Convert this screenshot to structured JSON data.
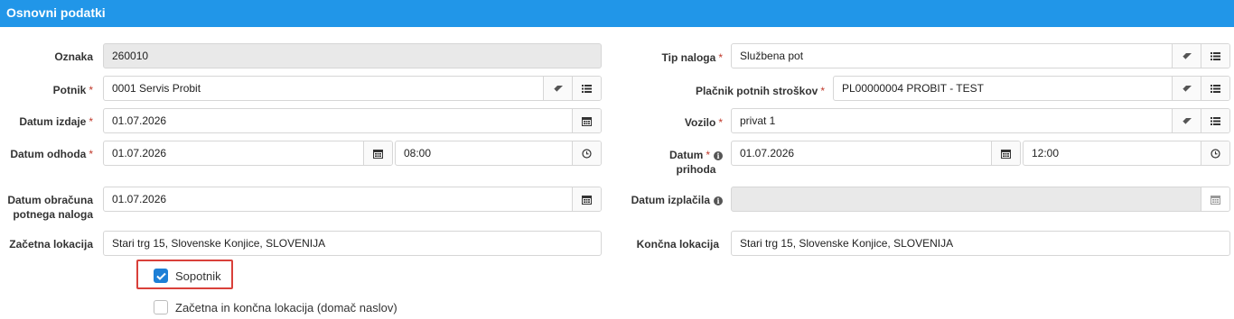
{
  "header": {
    "title": "Osnovni podatki"
  },
  "left": {
    "oznaka": {
      "label": "Oznaka",
      "value": "260010"
    },
    "potnik": {
      "label": "Potnik",
      "value": "0001 Servis Probit"
    },
    "datum_izdaje": {
      "label": "Datum izdaje",
      "value": "01.07.2026"
    },
    "datum_odhoda": {
      "label": "Datum odhoda",
      "date": "01.07.2026",
      "time": "08:00"
    },
    "datum_obracuna": {
      "label_line1": "Datum obračuna",
      "label_line2": "potnega naloga",
      "value": "01.07.2026"
    },
    "zacetna_lokacija": {
      "label": "Začetna lokacija",
      "value": "Stari trg 15, Slovenske Konjice, SLOVENIJA"
    }
  },
  "right": {
    "tip_naloga": {
      "label": "Tip naloga",
      "value": "Službena pot"
    },
    "placnik": {
      "label": "Plačnik potnih stroškov",
      "value": "PL00000004 PROBIT - TEST"
    },
    "vozilo": {
      "label": "Vozilo",
      "value": "privat 1"
    },
    "datum_prihoda": {
      "label_line1": "Datum",
      "label_line2": "prihoda",
      "date": "01.07.2026",
      "time": "12:00"
    },
    "datum_izplacila": {
      "label": "Datum izplačila",
      "value": ""
    },
    "koncna_lokacija": {
      "label": "Končna lokacija",
      "value": "Stari trg 15, Slovenske Konjice, SLOVENIJA"
    }
  },
  "checkboxes": {
    "sopotnik": {
      "label": "Sopotnik",
      "checked": true
    },
    "domac_naslov": {
      "label": "Začetna in končna lokacija (domač naslov)",
      "checked": false
    }
  },
  "required_marker": "*",
  "info_glyph": "i",
  "colors": {
    "header": "#2196e8",
    "required": "#c0392b",
    "checkbox_on": "#1d7fd6",
    "highlight": "#d9403a"
  },
  "icons": [
    "eraser-icon",
    "list-icon",
    "calendar-icon",
    "clock-icon",
    "info-icon",
    "check-icon"
  ]
}
